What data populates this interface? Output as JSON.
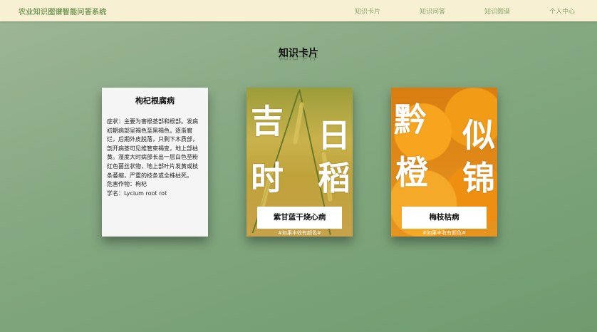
{
  "header": {
    "brand": "农业知识图谱智能问答系统",
    "nav": [
      "知识卡片",
      "知识问答",
      "知识图谱",
      "个人中心"
    ]
  },
  "page": {
    "title": "知识卡片"
  },
  "cards": [
    {
      "title": "枸杞根腐病",
      "symptoms": "症状：主要为害根茎部和根部。发病初期病部呈褐色至黑褐色，逐渐腐烂，后期外皮脱落，只剩下木质部，剖开病茎可见维管束褐变，地上部枯黄。湿度大时病部长出一层白色至粉红色菌丝状物，地上部叶片发黄或枝条萎缩，严重的枝条或全株枯死。",
      "crop": "危害作物：枸杞",
      "sci_name": "学名：Lycium root rot"
    },
    {
      "title": "紫甘蓝干烧心病",
      "chars": [
        "吉",
        "日",
        "时",
        "稻"
      ],
      "tag": "#如果丰收有颜色#"
    },
    {
      "title": "梅枝枯病",
      "chars": [
        "黔",
        "似",
        "橙",
        "锦"
      ],
      "tag": "#如果丰收有颜色#"
    }
  ],
  "colors": {
    "topbar": "#f8f0d2",
    "brand": "#7a9b5d",
    "background": "#86a982"
  }
}
